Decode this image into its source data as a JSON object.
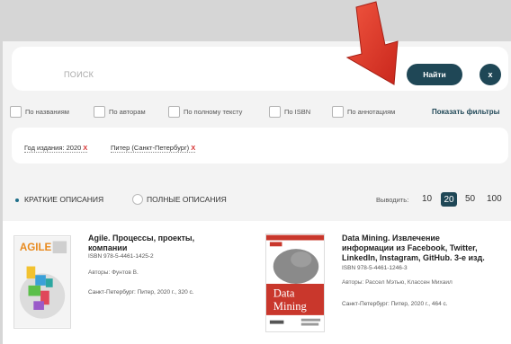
{
  "search": {
    "placeholder": "ПОИСК",
    "find_label": "Найти",
    "close_label": "x"
  },
  "filters": {
    "items": [
      "По названиям",
      "По авторам",
      "По полному тексту",
      "По ISBN",
      "По аннотациям"
    ],
    "show_filters_label": "Показать фильтры"
  },
  "tags": {
    "year": "Год издания: 2020",
    "publisher": "Питер (Санкт-Петербург)",
    "remove_glyph": "X"
  },
  "view": {
    "short_label": "КРАТКИЕ ОПИСАНИЯ",
    "full_label": "ПОЛНЫЕ ОПИСАНИЯ",
    "per_page_label": "Выводить:",
    "per_page_options": [
      "10",
      "20",
      "50",
      "100"
    ],
    "per_page_selected": "20"
  },
  "books": [
    {
      "title_line1": "Agile. Процессы, проекты,",
      "title_line2": "компании",
      "isbn": "ISBN 978-5-4461-1425-2",
      "authors": "Авторы: Фунтов В.",
      "publication": "Санкт-Петербург: Питер, 2020 г., 320 с.",
      "cover_text": "AGILE"
    },
    {
      "title_line1": "Data Mining. Извлечение",
      "title_line2": "информации из Facebook, Twitter,",
      "title_line3": "LinkedIn, Instagram, GitHub. 3-е изд.",
      "isbn": "ISBN 978-5-4461-1246-3",
      "authors": "Авторы: Рассел Мэтью, Классен Михаил",
      "publication": "Санкт-Петербург: Питер, 2020 г., 464 с.",
      "cover_text_1": "Data",
      "cover_text_2": "Mining"
    }
  ],
  "colors": {
    "accent": "#1f4756",
    "remove": "#d63030",
    "arrow": "#e23a2c"
  }
}
